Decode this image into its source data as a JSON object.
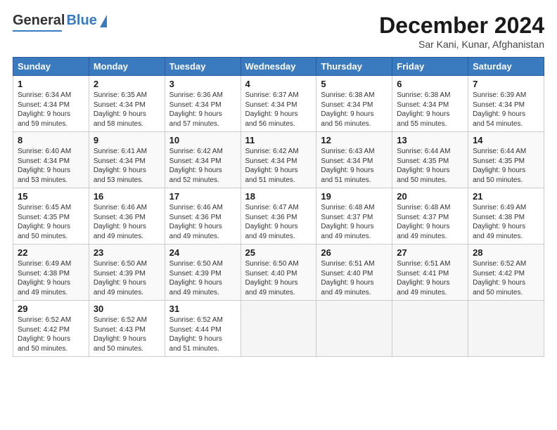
{
  "header": {
    "logo_general": "General",
    "logo_blue": "Blue",
    "title": "December 2024",
    "subtitle": "Sar Kani, Kunar, Afghanistan"
  },
  "days_of_week": [
    "Sunday",
    "Monday",
    "Tuesday",
    "Wednesday",
    "Thursday",
    "Friday",
    "Saturday"
  ],
  "weeks": [
    [
      {
        "day": "1",
        "info": "Sunrise: 6:34 AM\nSunset: 4:34 PM\nDaylight: 9 hours\nand 59 minutes."
      },
      {
        "day": "2",
        "info": "Sunrise: 6:35 AM\nSunset: 4:34 PM\nDaylight: 9 hours\nand 58 minutes."
      },
      {
        "day": "3",
        "info": "Sunrise: 6:36 AM\nSunset: 4:34 PM\nDaylight: 9 hours\nand 57 minutes."
      },
      {
        "day": "4",
        "info": "Sunrise: 6:37 AM\nSunset: 4:34 PM\nDaylight: 9 hours\nand 56 minutes."
      },
      {
        "day": "5",
        "info": "Sunrise: 6:38 AM\nSunset: 4:34 PM\nDaylight: 9 hours\nand 56 minutes."
      },
      {
        "day": "6",
        "info": "Sunrise: 6:38 AM\nSunset: 4:34 PM\nDaylight: 9 hours\nand 55 minutes."
      },
      {
        "day": "7",
        "info": "Sunrise: 6:39 AM\nSunset: 4:34 PM\nDaylight: 9 hours\nand 54 minutes."
      }
    ],
    [
      {
        "day": "8",
        "info": "Sunrise: 6:40 AM\nSunset: 4:34 PM\nDaylight: 9 hours\nand 53 minutes."
      },
      {
        "day": "9",
        "info": "Sunrise: 6:41 AM\nSunset: 4:34 PM\nDaylight: 9 hours\nand 53 minutes."
      },
      {
        "day": "10",
        "info": "Sunrise: 6:42 AM\nSunset: 4:34 PM\nDaylight: 9 hours\nand 52 minutes."
      },
      {
        "day": "11",
        "info": "Sunrise: 6:42 AM\nSunset: 4:34 PM\nDaylight: 9 hours\nand 51 minutes."
      },
      {
        "day": "12",
        "info": "Sunrise: 6:43 AM\nSunset: 4:34 PM\nDaylight: 9 hours\nand 51 minutes."
      },
      {
        "day": "13",
        "info": "Sunrise: 6:44 AM\nSunset: 4:35 PM\nDaylight: 9 hours\nand 50 minutes."
      },
      {
        "day": "14",
        "info": "Sunrise: 6:44 AM\nSunset: 4:35 PM\nDaylight: 9 hours\nand 50 minutes."
      }
    ],
    [
      {
        "day": "15",
        "info": "Sunrise: 6:45 AM\nSunset: 4:35 PM\nDaylight: 9 hours\nand 50 minutes."
      },
      {
        "day": "16",
        "info": "Sunrise: 6:46 AM\nSunset: 4:36 PM\nDaylight: 9 hours\nand 49 minutes."
      },
      {
        "day": "17",
        "info": "Sunrise: 6:46 AM\nSunset: 4:36 PM\nDaylight: 9 hours\nand 49 minutes."
      },
      {
        "day": "18",
        "info": "Sunrise: 6:47 AM\nSunset: 4:36 PM\nDaylight: 9 hours\nand 49 minutes."
      },
      {
        "day": "19",
        "info": "Sunrise: 6:48 AM\nSunset: 4:37 PM\nDaylight: 9 hours\nand 49 minutes."
      },
      {
        "day": "20",
        "info": "Sunrise: 6:48 AM\nSunset: 4:37 PM\nDaylight: 9 hours\nand 49 minutes."
      },
      {
        "day": "21",
        "info": "Sunrise: 6:49 AM\nSunset: 4:38 PM\nDaylight: 9 hours\nand 49 minutes."
      }
    ],
    [
      {
        "day": "22",
        "info": "Sunrise: 6:49 AM\nSunset: 4:38 PM\nDaylight: 9 hours\nand 49 minutes."
      },
      {
        "day": "23",
        "info": "Sunrise: 6:50 AM\nSunset: 4:39 PM\nDaylight: 9 hours\nand 49 minutes."
      },
      {
        "day": "24",
        "info": "Sunrise: 6:50 AM\nSunset: 4:39 PM\nDaylight: 9 hours\nand 49 minutes."
      },
      {
        "day": "25",
        "info": "Sunrise: 6:50 AM\nSunset: 4:40 PM\nDaylight: 9 hours\nand 49 minutes."
      },
      {
        "day": "26",
        "info": "Sunrise: 6:51 AM\nSunset: 4:40 PM\nDaylight: 9 hours\nand 49 minutes."
      },
      {
        "day": "27",
        "info": "Sunrise: 6:51 AM\nSunset: 4:41 PM\nDaylight: 9 hours\nand 49 minutes."
      },
      {
        "day": "28",
        "info": "Sunrise: 6:52 AM\nSunset: 4:42 PM\nDaylight: 9 hours\nand 50 minutes."
      }
    ],
    [
      {
        "day": "29",
        "info": "Sunrise: 6:52 AM\nSunset: 4:42 PM\nDaylight: 9 hours\nand 50 minutes."
      },
      {
        "day": "30",
        "info": "Sunrise: 6:52 AM\nSunset: 4:43 PM\nDaylight: 9 hours\nand 50 minutes."
      },
      {
        "day": "31",
        "info": "Sunrise: 6:52 AM\nSunset: 4:44 PM\nDaylight: 9 hours\nand 51 minutes."
      },
      {
        "day": "",
        "info": ""
      },
      {
        "day": "",
        "info": ""
      },
      {
        "day": "",
        "info": ""
      },
      {
        "day": "",
        "info": ""
      }
    ]
  ]
}
